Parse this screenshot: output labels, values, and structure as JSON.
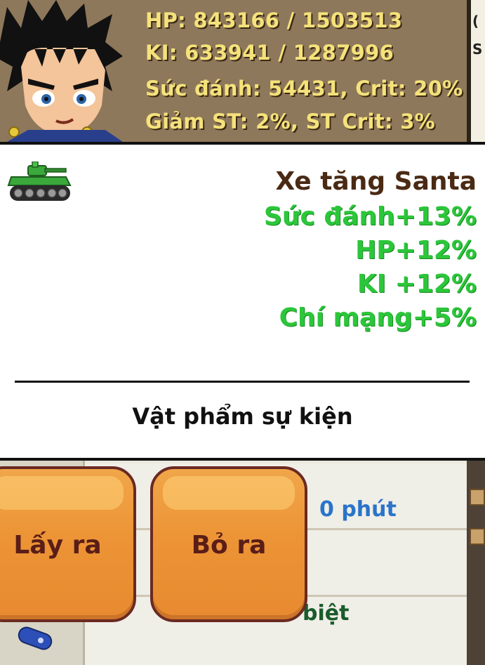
{
  "stats": {
    "hp": "HP: 843166 / 1503513",
    "ki": "KI: 633941 / 1287996",
    "attack": "Sức đánh: 54431, Crit: 20%",
    "defense": "Giảm ST: 2%, ST Crit: 3%"
  },
  "item": {
    "name": "Xe tăng Santa",
    "bonuses": [
      "Sức đánh+13%",
      "HP+12%",
      "KI +12%",
      "Chí mạng+5%"
    ],
    "category": "Vật phẩm sự kiện"
  },
  "list": {
    "row0_fragment": "0 phút",
    "row2_fragment": "biệt"
  },
  "buttons": {
    "take": "Lấy ra",
    "discard": "Bỏ ra"
  },
  "colors": {
    "stat_text": "#f5e27b",
    "item_name": "#4a2a14",
    "bonus": "#2cc63a",
    "button": "#ec9436"
  }
}
